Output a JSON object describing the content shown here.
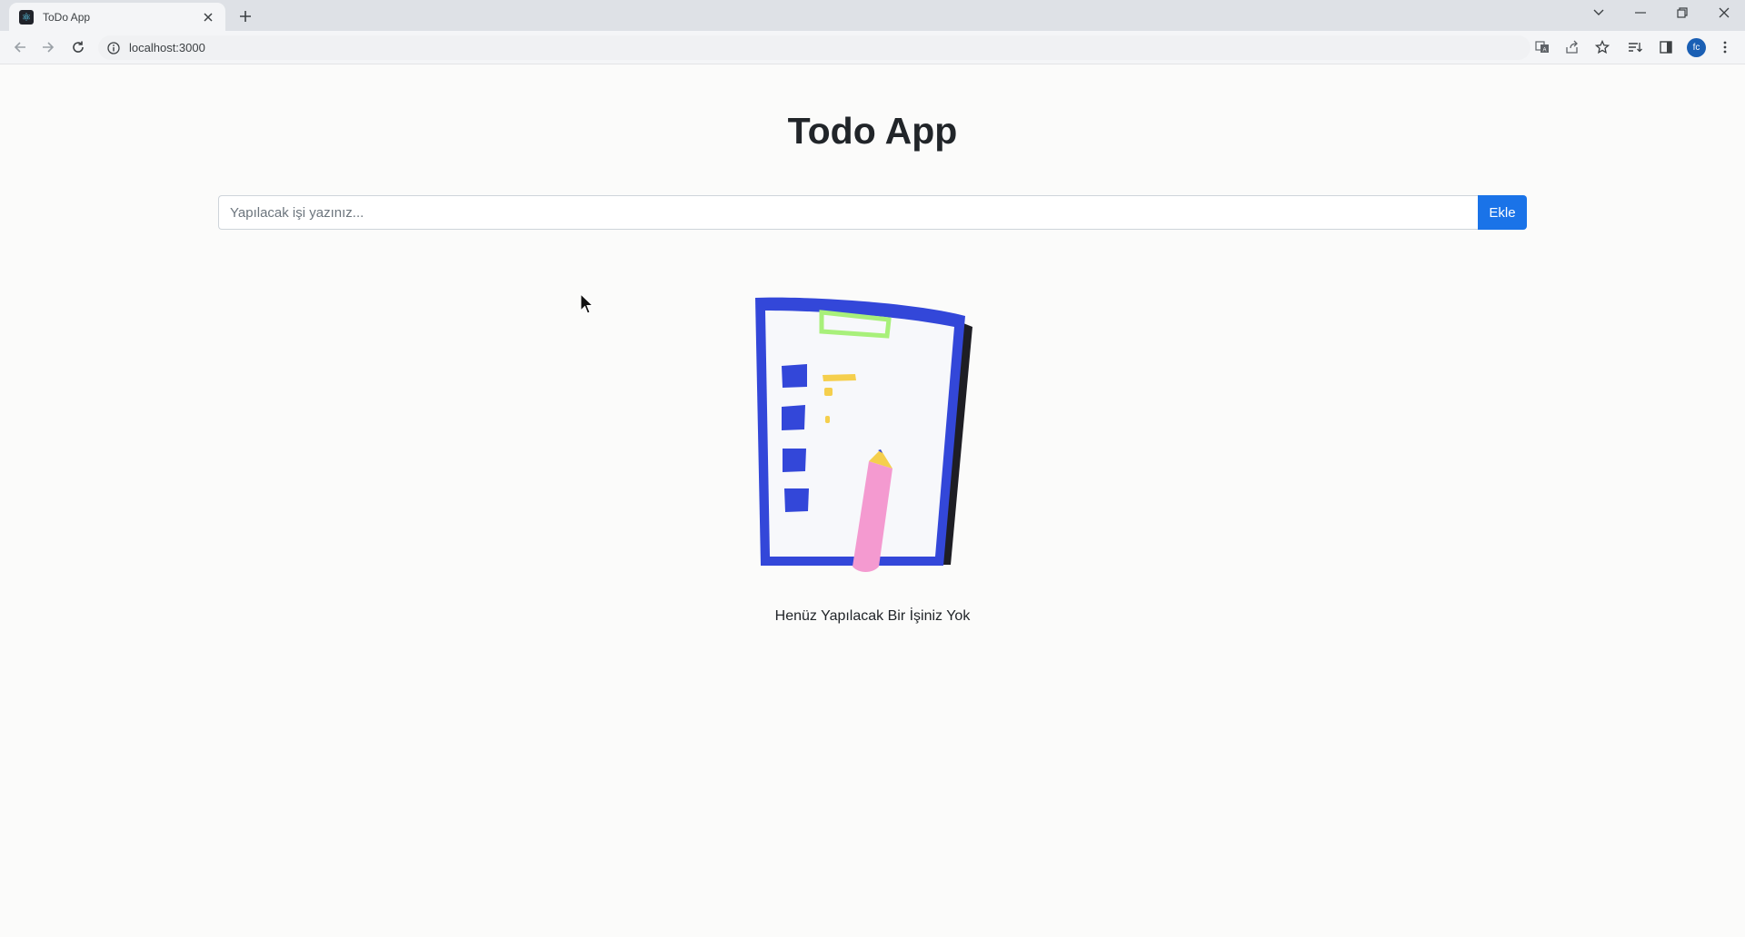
{
  "browser": {
    "tab": {
      "title": "ToDo App"
    },
    "address": "localhost:3000",
    "profile_initials": "fc"
  },
  "app": {
    "title": "Todo App",
    "input": {
      "placeholder": "Yapılacak işi yazınız...",
      "value": ""
    },
    "add_button_label": "Ekle",
    "empty_message": "Henüz Yapılacak Bir İşiniz Yok"
  },
  "colors": {
    "accent": "#1a73e8",
    "illustration_blue": "#3347d9",
    "illustration_pink": "#f49ad0",
    "illustration_yellow": "#f5cf4d",
    "illustration_green": "#a8f07a"
  },
  "icons": {
    "tab_favicon": "react-icon",
    "tab_close": "close-icon",
    "new_tab": "plus-icon",
    "back": "arrow-left-icon",
    "forward": "arrow-right-icon",
    "reload": "reload-icon",
    "site_info": "info-icon",
    "translate": "translate-icon",
    "share": "share-icon",
    "bookmark": "star-icon",
    "reading_list": "reading-list-icon",
    "side_panel": "side-panel-icon",
    "menu": "kebab-menu-icon"
  }
}
